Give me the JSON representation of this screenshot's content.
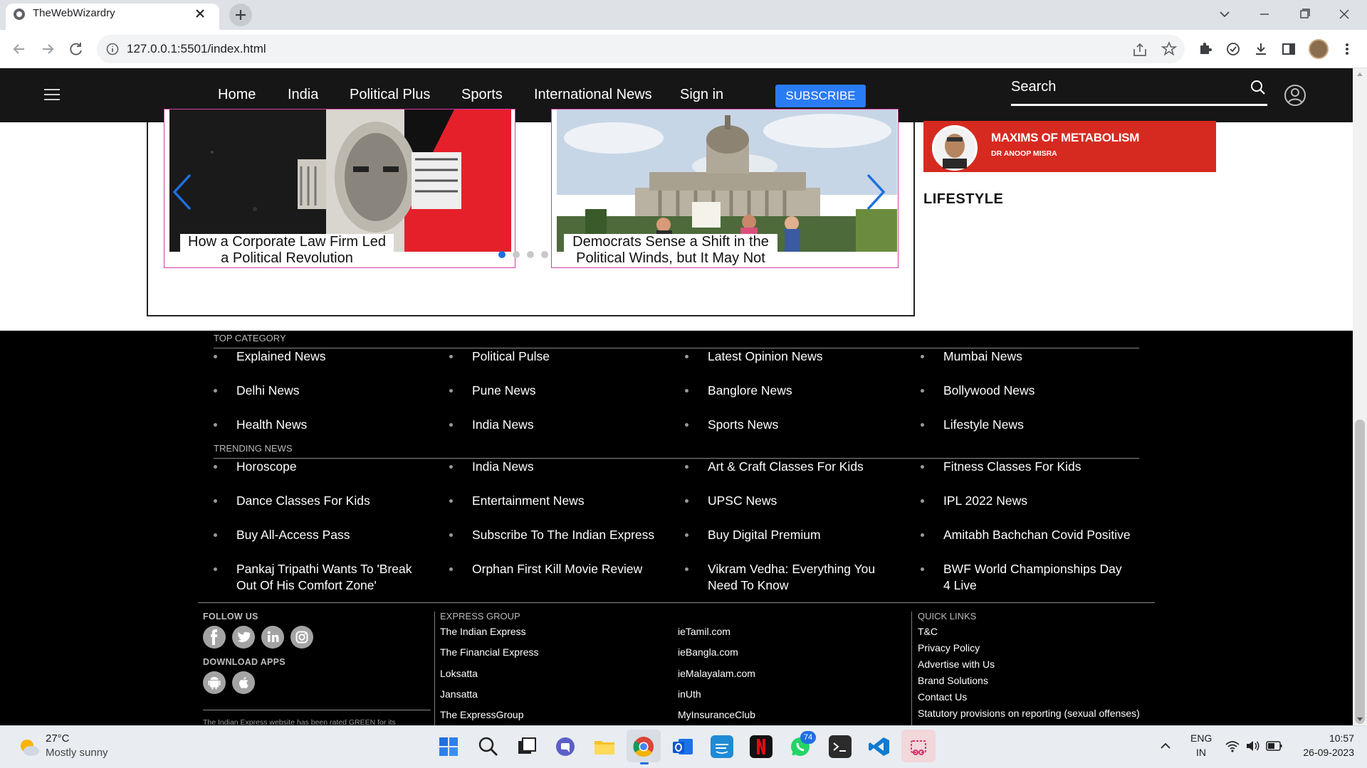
{
  "browser": {
    "tab_title": "TheWebWizardry",
    "url": "127.0.0.1:5501/index.html"
  },
  "navbar": {
    "links": [
      "Home",
      "India",
      "Political Plus",
      "Sports",
      "International News",
      "Sign in"
    ],
    "subscribe_label": "SUBSCRIBE",
    "search_label": "Search"
  },
  "slider": {
    "slides": [
      {
        "caption": "How a Corporate Law Firm Led a Political Revolution",
        "image": "illustration-man-red-background"
      },
      {
        "caption": "Democrats Sense a Shift in the Political Winds, but It May Not Be",
        "image": "photo-capitol-protest"
      }
    ],
    "active_dot": 0,
    "dot_count": 4
  },
  "sidebar": {
    "ad_title": "MAXIMS OF METABOLISM",
    "ad_author": "DR ANOOP MISRA",
    "section_title": "LIFESTYLE"
  },
  "footer": {
    "top_category": {
      "heading": "TOP CATEGORY",
      "columns": [
        [
          "Explained News",
          "Delhi News",
          "Health News"
        ],
        [
          "Political Pulse",
          "Pune News",
          "India News"
        ],
        [
          "Latest Opinion News",
          "Banglore News",
          "Sports News"
        ],
        [
          "Mumbai News",
          "Bollywood News",
          "Lifestyle News"
        ]
      ]
    },
    "trending": {
      "heading": "TRENDING NEWS",
      "columns": [
        [
          "Horoscope",
          "Dance Classes For Kids",
          "Buy All-Access Pass",
          "Pankaj Tripathi Wants To 'Break Out Of His Comfort Zone'"
        ],
        [
          "India News",
          "Entertainment News",
          "Subscribe To The Indian Express",
          "Orphan First Kill Movie Review"
        ],
        [
          "Art & Craft Classes For Kids",
          "UPSC News",
          "Buy Digital Premium",
          "Vikram Vedha: Everything You Need To Know"
        ],
        [
          "Fitness Classes For Kids",
          "IPL 2022 News",
          "Amitabh Bachchan Covid Positive",
          "BWF World Championships Day 4 Live"
        ]
      ]
    },
    "follow_us": "FOLLOW US",
    "social": [
      "facebook-icon",
      "twitter-icon",
      "linkedin-icon",
      "instagram-icon"
    ],
    "download_apps": "DOWNLOAD APPS",
    "apps": [
      "android-icon",
      "apple-icon"
    ],
    "rating_note": "The Indian Express website has been rated GREEN for its",
    "express_group": {
      "heading": "EXPRESS GROUP",
      "col1": [
        "The Indian Express",
        "The Financial Express",
        "Loksatta",
        "Jansatta",
        "The ExpressGroup"
      ],
      "col2": [
        "ieTamil.com",
        "ieBangla.com",
        "ieMalayalam.com",
        "inUth",
        "MyInsuranceClub"
      ]
    },
    "quick_links": {
      "heading": "QUICK LINKS",
      "items": [
        "T&C",
        "Privacy Policy",
        "Advertise with Us",
        "Brand Solutions",
        "Contact Us",
        "Statutory provisions on reporting (sexual offenses)"
      ]
    }
  },
  "taskbar": {
    "weather_temp": "27°C",
    "weather_desc": "Mostly sunny",
    "whatsapp_badge": "74",
    "lang_line1": "ENG",
    "lang_line2": "IN",
    "time": "10:57",
    "date": "26-09-2023",
    "colors": {
      "accent": "#2a7bf6",
      "slide_border": "#d63aa5",
      "ad_red": "#d62a20"
    }
  }
}
